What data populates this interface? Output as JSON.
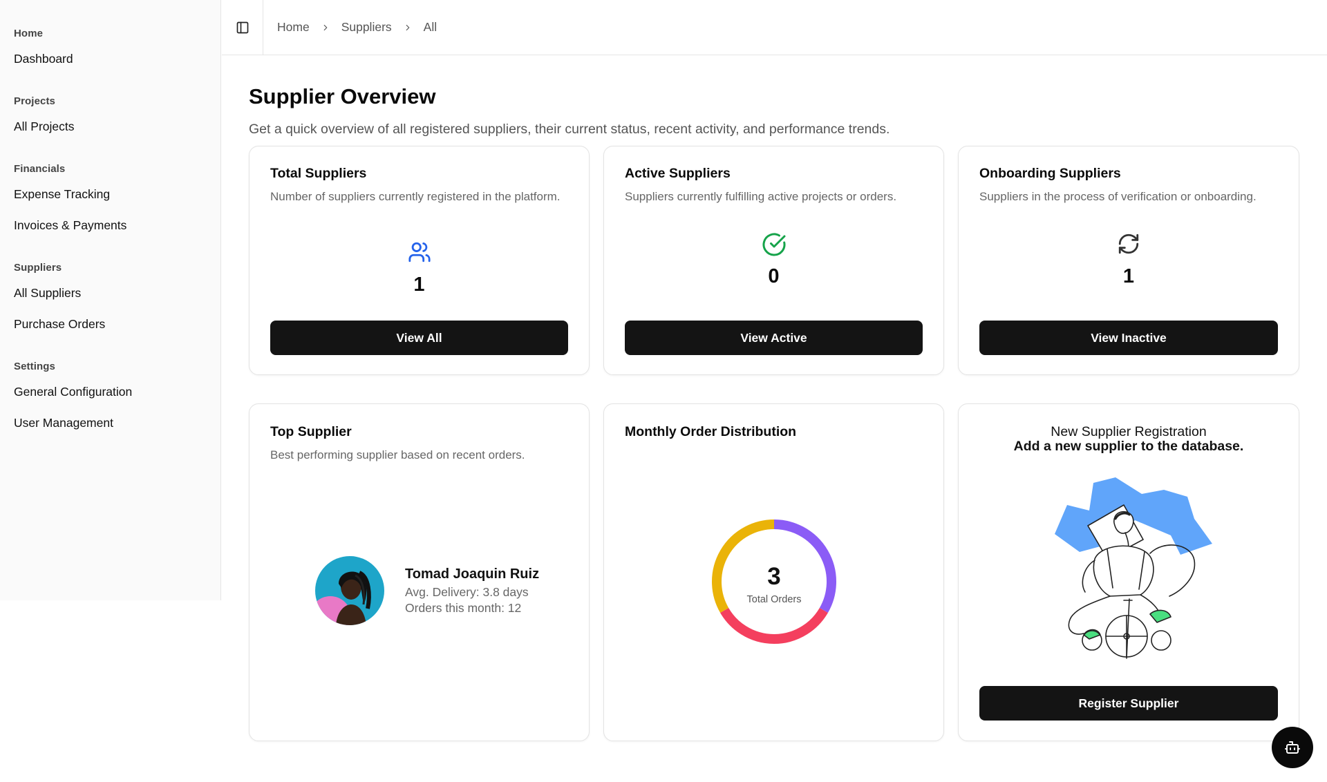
{
  "sidebar": {
    "groups": [
      {
        "title": "Home",
        "items": [
          "Dashboard"
        ]
      },
      {
        "title": "Projects",
        "items": [
          "All Projects"
        ]
      },
      {
        "title": "Financials",
        "items": [
          "Expense Tracking",
          "Invoices & Payments"
        ]
      },
      {
        "title": "Suppliers",
        "items": [
          "All Suppliers",
          "Purchase Orders"
        ]
      },
      {
        "title": "Settings",
        "items": [
          "General Configuration",
          "User Management"
        ]
      }
    ]
  },
  "breadcrumb": [
    "Home",
    "Suppliers",
    "All"
  ],
  "page": {
    "title": "Supplier Overview",
    "subtitle": "Get a quick overview of all registered suppliers, their current status, recent activity, and performance trends."
  },
  "stats": [
    {
      "title": "Total Suppliers",
      "desc": "Number of suppliers currently registered in the platform.",
      "value": "1",
      "button": "View All",
      "icon": "users-icon",
      "color": "#2563eb"
    },
    {
      "title": "Active Suppliers",
      "desc": "Suppliers currently fulfilling active projects or orders.",
      "value": "0",
      "button": "View Active",
      "icon": "check-circle-icon",
      "color": "#16a34a"
    },
    {
      "title": "Onboarding Suppliers",
      "desc": "Suppliers in the process of verification or onboarding.",
      "value": "1",
      "button": "View Inactive",
      "icon": "refresh-icon",
      "color": "#333333"
    }
  ],
  "top_supplier": {
    "title": "Top Supplier",
    "desc": "Best performing supplier based on recent orders.",
    "name": "Tomad Joaquin Ruiz",
    "delivery": "Avg. Delivery: 3.8 days",
    "orders": "Orders this month: 12"
  },
  "distribution": {
    "title": "Monthly Order Distribution",
    "total": "3",
    "total_label": "Total Orders",
    "segments": [
      {
        "value": 1,
        "color": "#8b5cf6"
      },
      {
        "value": 1,
        "color": "#f43f5e"
      },
      {
        "value": 1,
        "color": "#eab308"
      }
    ]
  },
  "registration": {
    "title": "New Supplier Registration",
    "subtitle": "Add a new supplier to the database.",
    "button": "Register Supplier"
  },
  "colors": {
    "button_bg": "#141414",
    "sidebar_bg": "#fafafa",
    "illustration_blue": "#60a5fa",
    "illustration_green": "#4ade80"
  }
}
